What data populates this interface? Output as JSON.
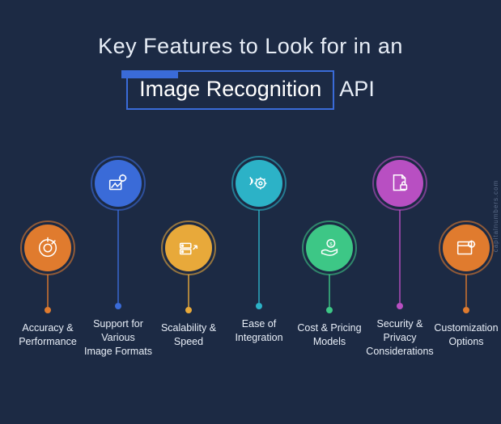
{
  "title": {
    "line1": "Key Features to Look for in an",
    "highlight": "Image Recognition",
    "suffix": "API"
  },
  "features": [
    {
      "label": "Accuracy &\nPerformance"
    },
    {
      "label": "Support for\nVarious\nImage Formats"
    },
    {
      "label": "Scalability &\nSpeed"
    },
    {
      "label": "Ease of\nIntegration"
    },
    {
      "label": "Cost & Pricing\nModels"
    },
    {
      "label": "Security &\nPrivacy\nConsiderations"
    },
    {
      "label": "Customization\nOptions"
    }
  ],
  "watermark": "capitalnumbers.com"
}
